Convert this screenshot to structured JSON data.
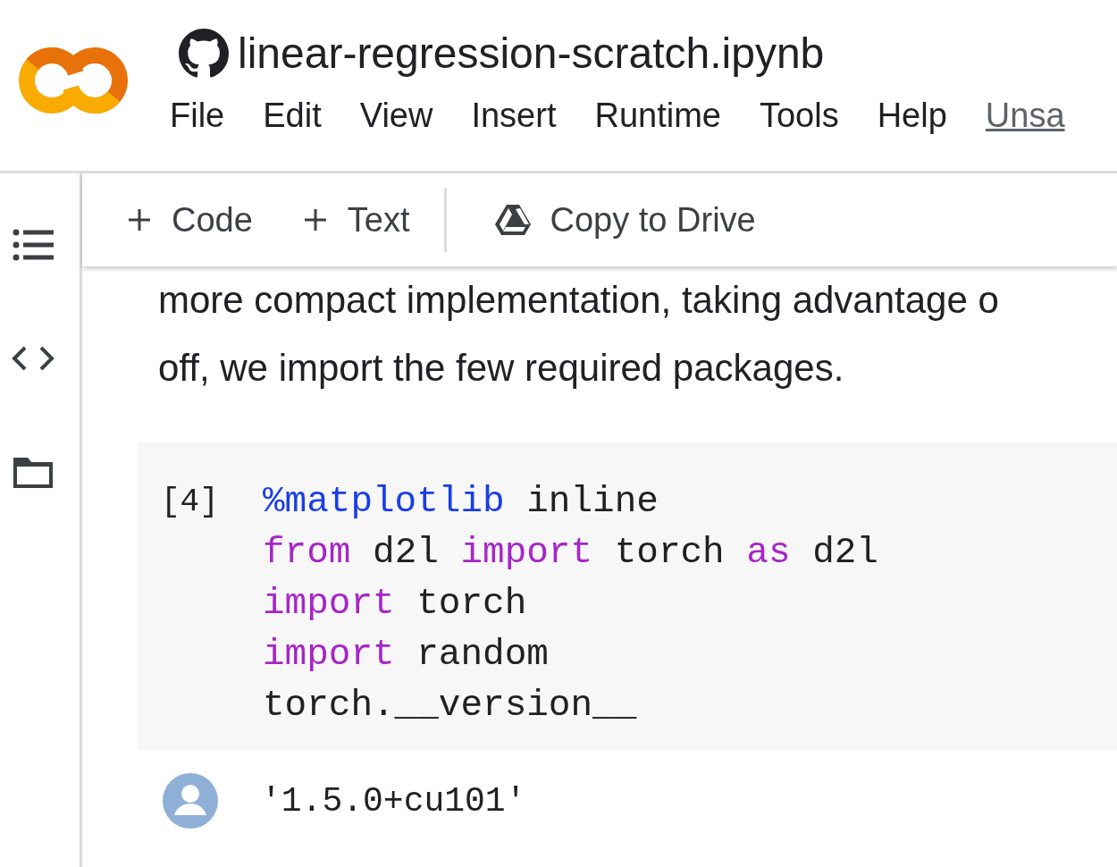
{
  "title": "linear-regression-scratch.ipynb",
  "menu": [
    {
      "label": "File",
      "kind": "menu"
    },
    {
      "label": "Edit",
      "kind": "menu"
    },
    {
      "label": "View",
      "kind": "menu"
    },
    {
      "label": "Insert",
      "kind": "menu"
    },
    {
      "label": "Runtime",
      "kind": "menu"
    },
    {
      "label": "Tools",
      "kind": "menu"
    },
    {
      "label": "Help",
      "kind": "menu"
    },
    {
      "label": "Unsa",
      "kind": "link"
    }
  ],
  "toolbar": [
    {
      "label": "Code",
      "kind": "add"
    },
    {
      "label": "Text",
      "kind": "add"
    },
    {
      "label": "Copy to Drive",
      "kind": "drive"
    }
  ],
  "sidebar": [
    {
      "kind": "toc"
    },
    {
      "kind": "code"
    },
    {
      "kind": "files"
    }
  ],
  "text_cell": {
    "lines": [
      "more compact implementation, taking advantage o",
      "off, we import the few required packages."
    ]
  },
  "code_cell": {
    "execution_count": "[4]",
    "lines": [
      [
        {
          "text": "%matplotlib",
          "kind": "magic"
        },
        {
          "text": " inline",
          "kind": "plain"
        }
      ],
      [
        {
          "text": "from",
          "kind": "keyword"
        },
        {
          "text": " d2l ",
          "kind": "plain"
        },
        {
          "text": "import",
          "kind": "keyword"
        },
        {
          "text": " torch ",
          "kind": "plain"
        },
        {
          "text": "as",
          "kind": "keyword"
        },
        {
          "text": " d2l",
          "kind": "plain"
        }
      ],
      [
        {
          "text": "import",
          "kind": "keyword"
        },
        {
          "text": " torch",
          "kind": "plain"
        }
      ],
      [
        {
          "text": "import",
          "kind": "keyword"
        },
        {
          "text": " random",
          "kind": "plain"
        }
      ],
      [
        {
          "text": "torch.__version__",
          "kind": "plain"
        }
      ]
    ],
    "output": "'1.5.0+cu101'"
  }
}
